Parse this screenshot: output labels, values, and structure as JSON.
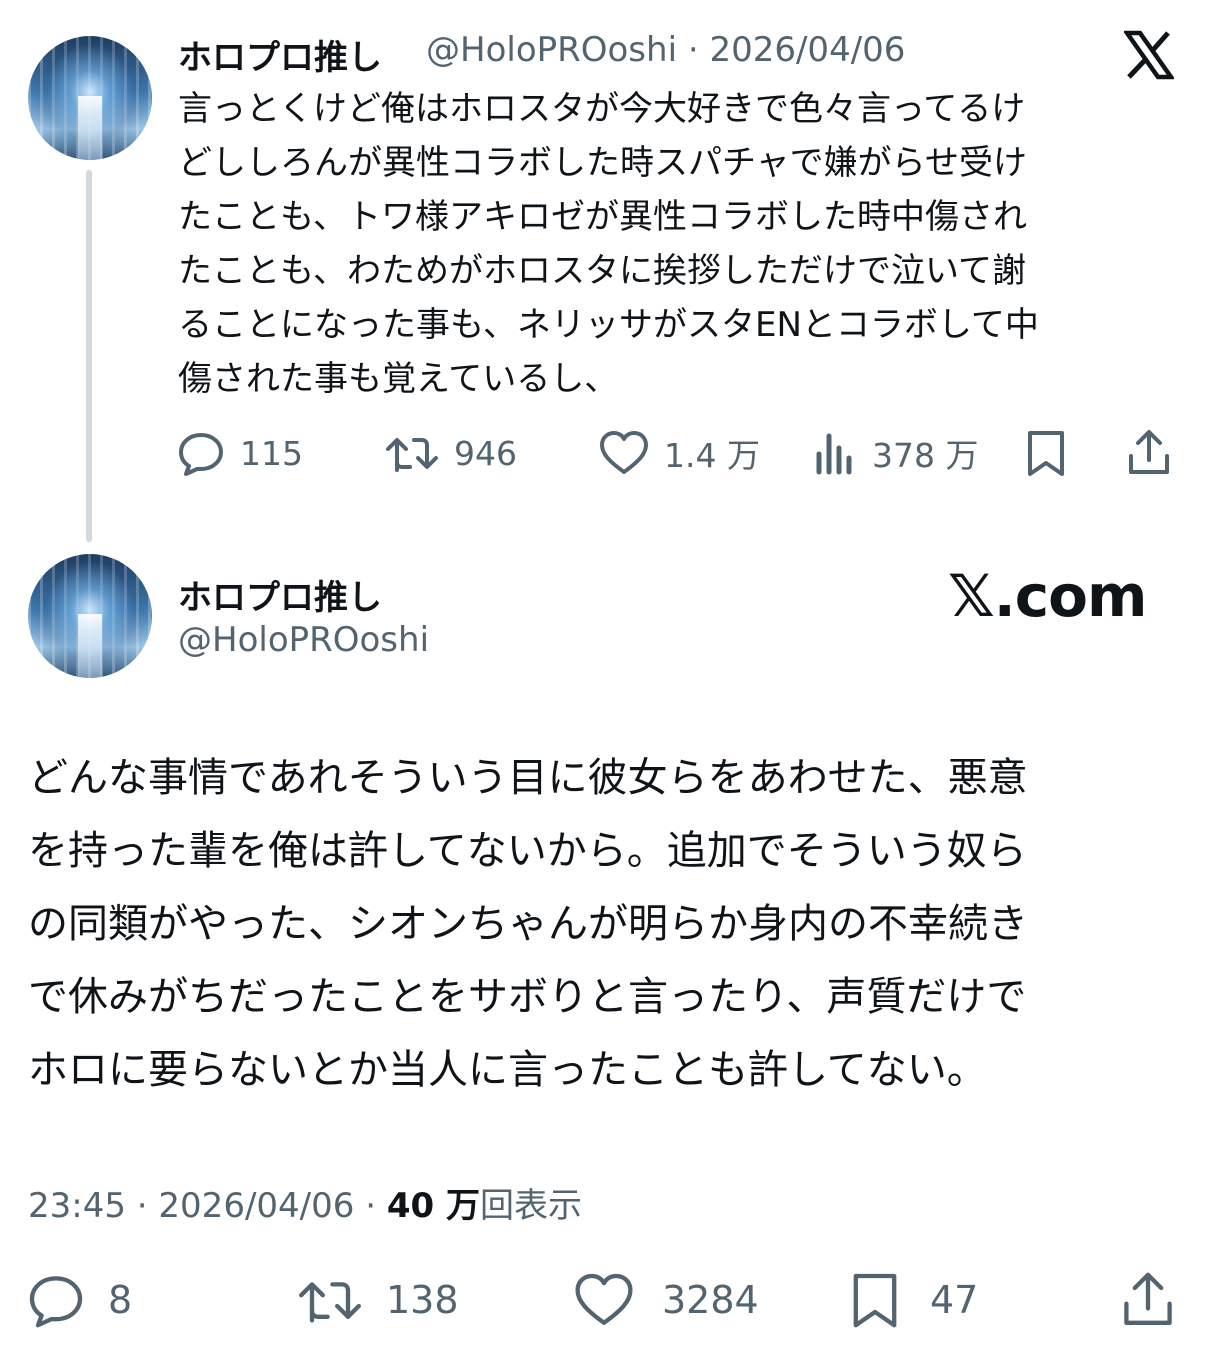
{
  "post1": {
    "name": "ホロプロ推し",
    "handle": "@HoloPROoshi",
    "separator": "·",
    "date": "2026/04/06",
    "text": "言っとくけど俺はホロスタが今大好きで色々言ってるけ\nどししろんが異性コラボした時スパチャで嫌がらせ受け\nたことも、トワ様アキロゼが異性コラボした時中傷され\nたことも、わためがホロスタに挨拶しただけで泣いて謝\nることになった事も、ネリッサがスタENとコラボして中\n傷された事も覚えているし、",
    "actions": {
      "replies": "115",
      "reposts": "946",
      "likes": "1.4 万",
      "views": "378 万"
    },
    "icons": [
      "x-logo-icon",
      "reply-icon",
      "repost-icon",
      "like-icon",
      "views-icon",
      "bookmark-icon",
      "share-icon"
    ]
  },
  "post2": {
    "name": "ホロプロ推し",
    "handle": "@HoloPROoshi",
    "brand": "𝕏.com",
    "text": "どんな事情であれそういう目に彼女らをあわせた、悪意\nを持った輩を俺は許してないから。追加でそういう奴ら\nの同類がやった、シオンちゃんが明らか身内の不幸続き\nで休みがちだったことをサボりと言ったり、声質だけで\nホロに要らないとか当人に言ったことも許してない。",
    "meta": {
      "time": "23:45",
      "separator": "·",
      "date": "2026/04/06",
      "views_count": "40 万",
      "views_label": "回表示"
    },
    "actions": {
      "replies": "8",
      "reposts": "138",
      "likes": "3284",
      "bookmarks": "47"
    }
  },
  "colors": {
    "text": "#0f1419",
    "secondary": "#536471",
    "thread_line": "#cfd9de"
  }
}
